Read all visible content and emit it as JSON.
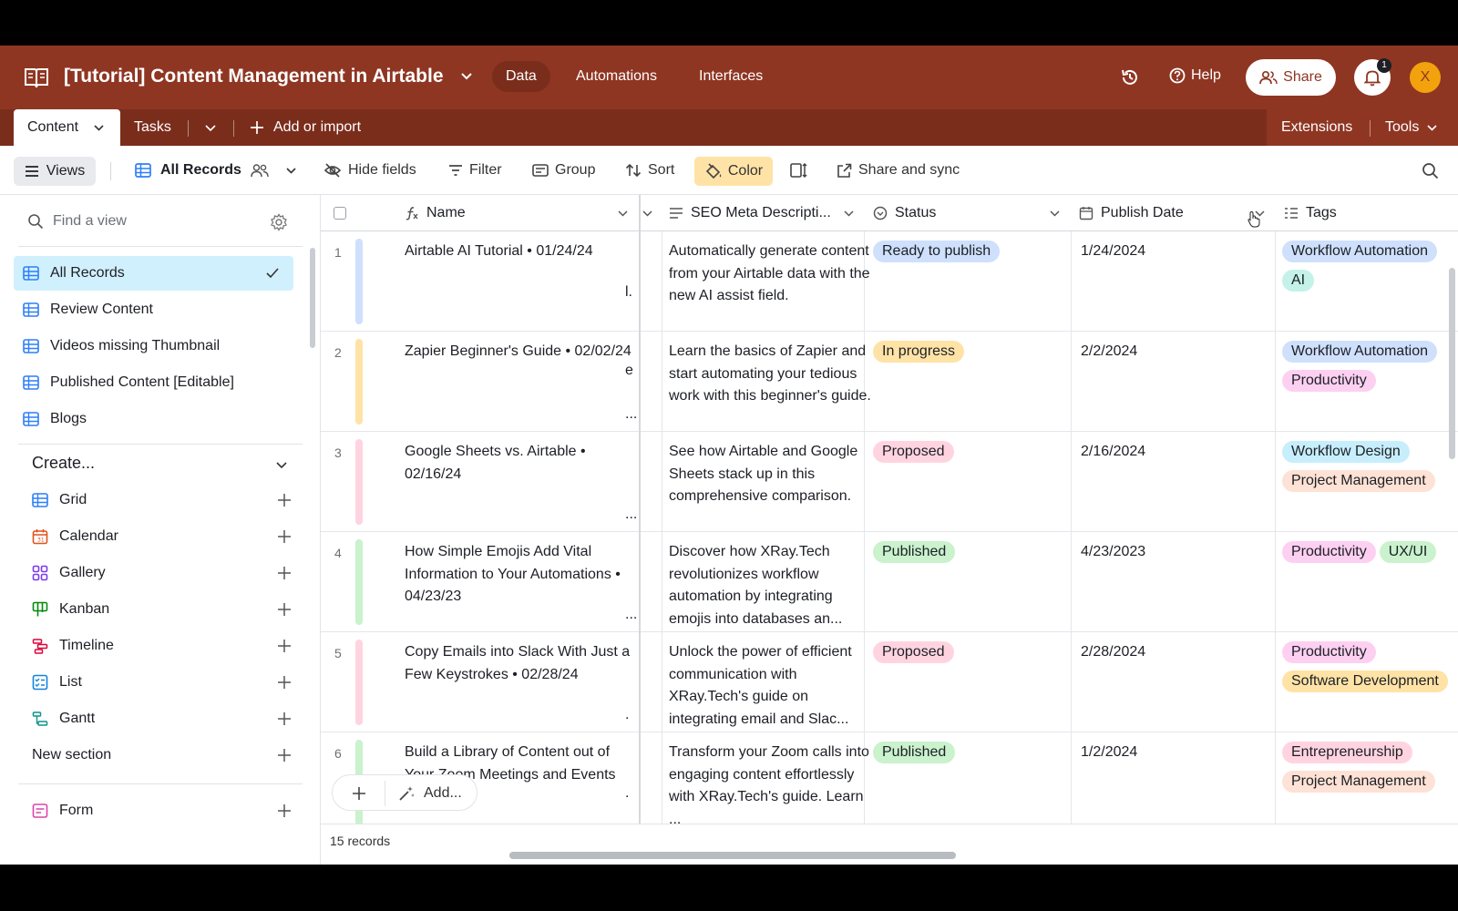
{
  "header": {
    "base_title": "[Tutorial] Content Management in Airtable",
    "nav": [
      "Data",
      "Automations",
      "Interfaces"
    ],
    "help_label": "Help",
    "share_label": "Share",
    "notification_count": "1",
    "avatar_initial": "X"
  },
  "tabs": {
    "active": "Content",
    "second": "Tasks",
    "add_label": "Add or import",
    "extensions": "Extensions",
    "tools": "Tools"
  },
  "viewbar": {
    "views_label": "Views",
    "current_view": "All Records",
    "hide_fields": "Hide fields",
    "filter": "Filter",
    "group": "Group",
    "sort": "Sort",
    "color": "Color",
    "share_sync": "Share and sync"
  },
  "sidebar": {
    "find_placeholder": "Find a view",
    "views": [
      "All Records",
      "Review Content",
      "Videos missing Thumbnail",
      "Published Content [Editable]",
      "Blogs"
    ],
    "create_title": "Create...",
    "create_items": [
      "Grid",
      "Calendar",
      "Gallery",
      "Kanban",
      "Timeline",
      "List",
      "Gantt"
    ],
    "new_section": "New section",
    "form": "Form"
  },
  "grid": {
    "columns": {
      "name": "Name",
      "seo": "SEO Meta Descripti...",
      "status": "Status",
      "publish_date": "Publish Date",
      "tags": "Tags"
    },
    "rows": [
      {
        "num": "1",
        "name": "Airtable AI Tutorial • 01/24/24",
        "seo": "Automatically generate content from your Airtable data with the new AI assist field.",
        "status": "Ready to publish",
        "date": "1/24/2024",
        "tags": [
          "Workflow Automation",
          "AI"
        ],
        "edge": "l."
      },
      {
        "num": "2",
        "name": "Zapier Beginner's Guide • 02/02/24",
        "seo": "Learn the basics of Zapier and start automating your tedious work with this beginner's guide.",
        "status": "In progress",
        "date": "2/2/2024",
        "tags": [
          "Workflow Automation",
          "Productivity"
        ],
        "edge": "e"
      },
      {
        "num": "3",
        "name": "Google Sheets vs. Airtable • 02/16/24",
        "seo": "See how Airtable and Google Sheets stack up in this comprehensive comparison.",
        "status": "Proposed",
        "date": "2/16/2024",
        "tags": [
          "Workflow Design",
          "Project Management"
        ],
        "edge": ""
      },
      {
        "num": "4",
        "name": "How Simple Emojis Add Vital Information to Your Automations • 04/23/23",
        "seo": "Discover how XRay.Tech revolutionizes workflow automation by integrating emojis into databases an...",
        "status": "Published",
        "date": "4/23/2023",
        "tags": [
          "Productivity",
          "UX/UI"
        ],
        "edge": ""
      },
      {
        "num": "5",
        "name": "Copy Emails into Slack With Just a Few Keystrokes • 02/28/24",
        "seo": "Unlock the power of efficient communication with XRay.Tech's guide on integrating email and Slac...",
        "status": "Proposed",
        "date": "2/28/2024",
        "tags": [
          "Productivity",
          "Software Development"
        ],
        "edge": ""
      },
      {
        "num": "6",
        "name": "Build a Library of Content out of Your Zoom Meetings and Events",
        "seo": "Transform your Zoom calls into engaging content effortlessly with XRay.Tech's guide. Learn ...",
        "status": "Published",
        "date": "1/2/2024",
        "tags": [
          "Entrepreneurship",
          "Project Management"
        ],
        "edge": ""
      }
    ],
    "add_label": "Add...",
    "record_count": "15 records"
  },
  "colors": {
    "header": "#8f3623",
    "ready": "#cfe0fc",
    "in_progress": "#ffe3a6",
    "proposed": "#ffd4e0",
    "published": "#c9f2cd"
  }
}
